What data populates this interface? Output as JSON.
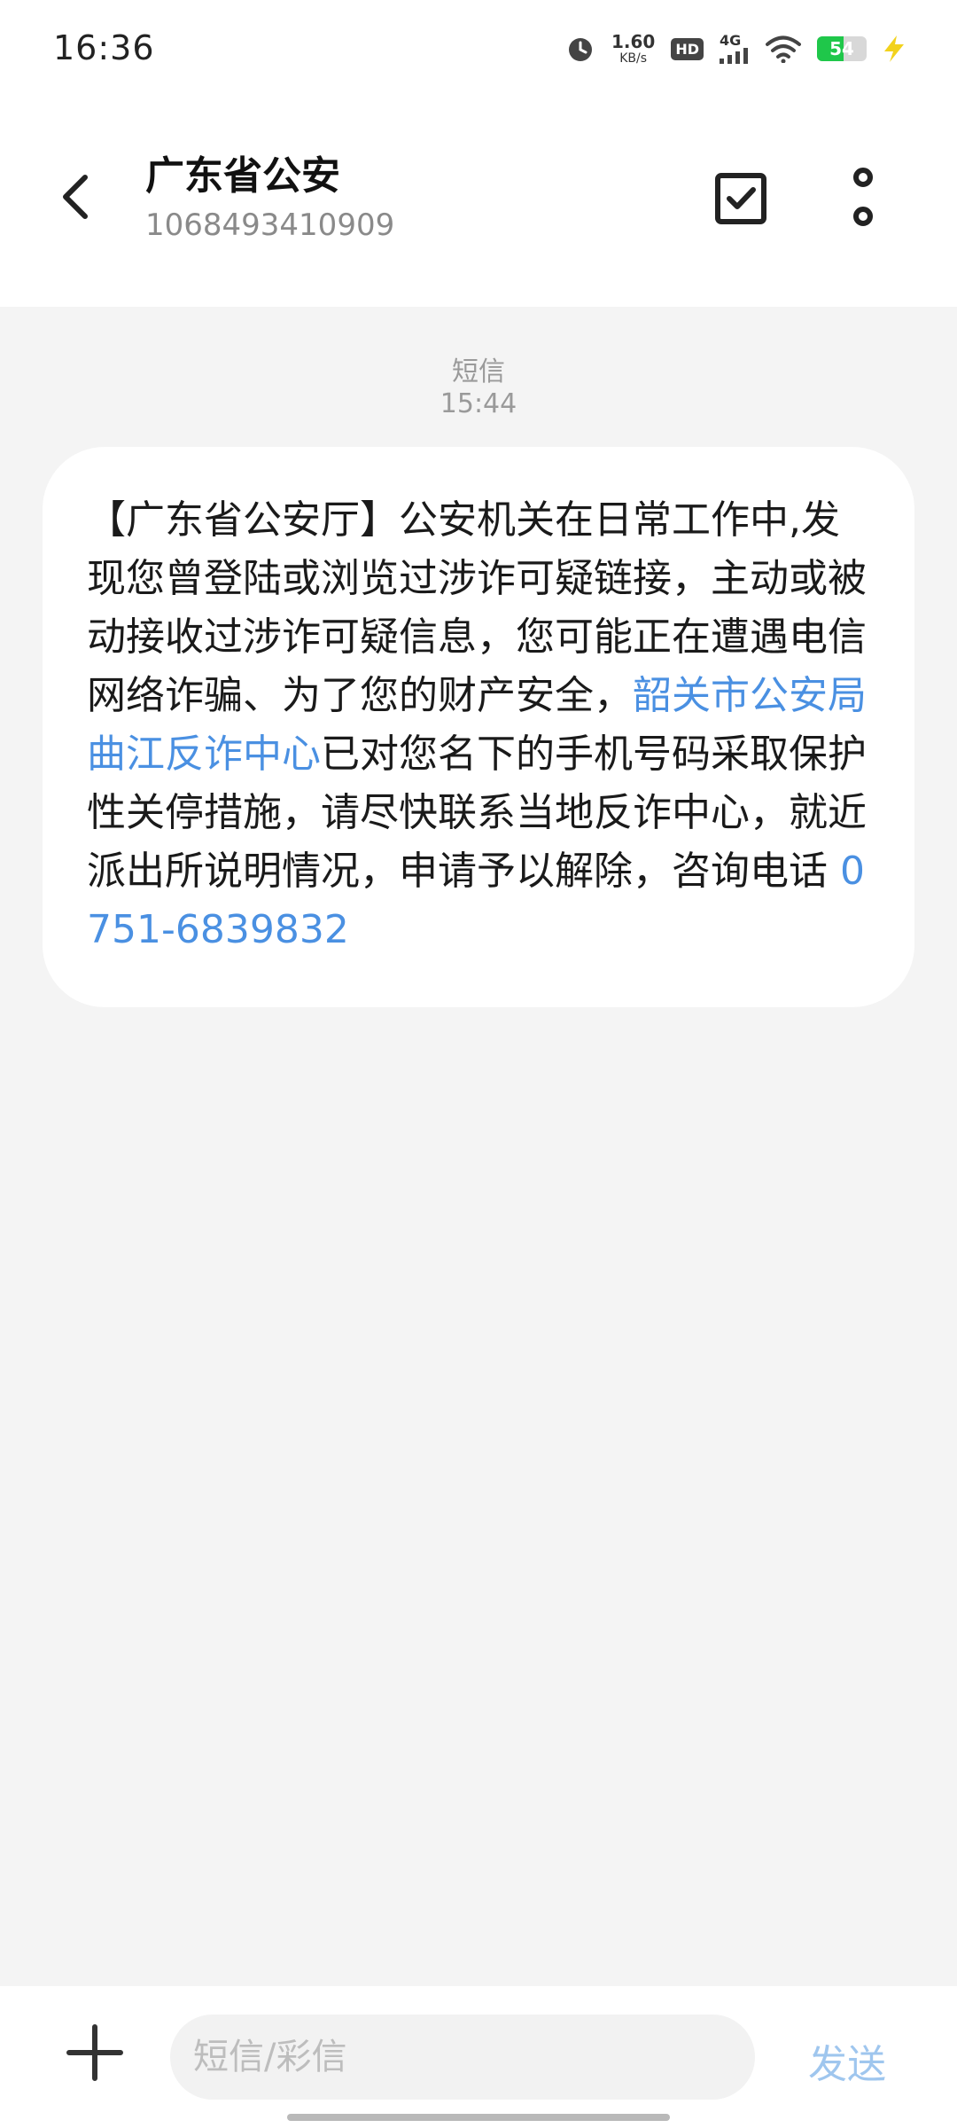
{
  "status_bar": {
    "time": "16:36",
    "net_speed_value": "1.60",
    "net_speed_unit": "KB/s",
    "hd_label": "HD",
    "network_label": "4G",
    "battery_level": "54",
    "battery_color": "#1fc74a",
    "icons": [
      "alarm-icon",
      "hd-icon",
      "signal-icon",
      "wifi-icon",
      "battery-icon",
      "charging-icon"
    ]
  },
  "header": {
    "contact_name": "广东省公安",
    "contact_number": "1068493410909"
  },
  "conversation": {
    "message_type": "短信",
    "message_time": "15:44",
    "message": {
      "text_part1": "【广东省公安厅】公安机关在日常工作中,发现您曾登陆或浏览过涉诈可疑链接，主动或被动接收过涉诈可疑信息，您可能正在遭遇电信网络诈骗、为了您的财产安全，",
      "link_text": "韶关市公安局曲江反诈中心",
      "text_part2": "已对您名下的手机号码采取保护性关停措施，请尽快联系当地反诈中心，就近派出所说明情况，申请予以解除，咨询电话 ",
      "phone_link": "0751-6839832"
    }
  },
  "input_bar": {
    "placeholder": "短信/彩信",
    "send_label": "发送"
  },
  "colors": {
    "link": "#4a90e2",
    "send_disabled": "#9fc6ee",
    "background": "#f4f4f4"
  }
}
